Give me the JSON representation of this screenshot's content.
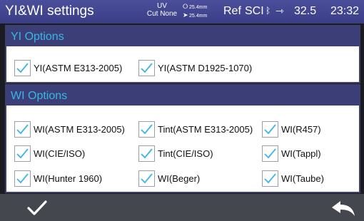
{
  "header": {
    "title": "YI&WI settings",
    "uv_label": "UV",
    "uv_value": "Cut None",
    "aperture_1": "25.4mm",
    "aperture_2": "25.4mm",
    "ref": "Ref",
    "mode": "SCI",
    "temperature": "32.5",
    "time": "23:32",
    "icons": [
      "aperture-circle-icon",
      "aperture-arrow-icon",
      "bluetooth-icon",
      "usb-icon"
    ]
  },
  "yi_panel": {
    "title": "YI Options",
    "options": [
      {
        "label": "YI(ASTM E313-2005)",
        "checked": true
      },
      {
        "label": "YI(ASTM D1925-1070)",
        "checked": true
      }
    ]
  },
  "wi_panel": {
    "title": "WI Options",
    "options": [
      {
        "label": "WI(ASTM E313-2005)",
        "checked": true
      },
      {
        "label": "Tint(ASTM E313-2005)",
        "checked": true
      },
      {
        "label": "WI(R457)",
        "checked": true
      },
      {
        "label": "WI(CIE/ISO)",
        "checked": true
      },
      {
        "label": "Tint(CIE/ISO)",
        "checked": true
      },
      {
        "label": "WI(Tappl)",
        "checked": true
      },
      {
        "label": "WI(Hunter 1960)",
        "checked": true
      },
      {
        "label": "WI(Beger)",
        "checked": true
      },
      {
        "label": "WI(Taube)",
        "checked": true
      }
    ]
  },
  "footer": {
    "confirm_icon": "checkmark-icon",
    "back_icon": "back-arrow-icon"
  },
  "colors": {
    "statusbar": "#3f4290",
    "panel_header": "#3c3f77",
    "panel_title": "#35b8e6",
    "check": "#3bb6e4",
    "bottombar": "#45474e"
  }
}
